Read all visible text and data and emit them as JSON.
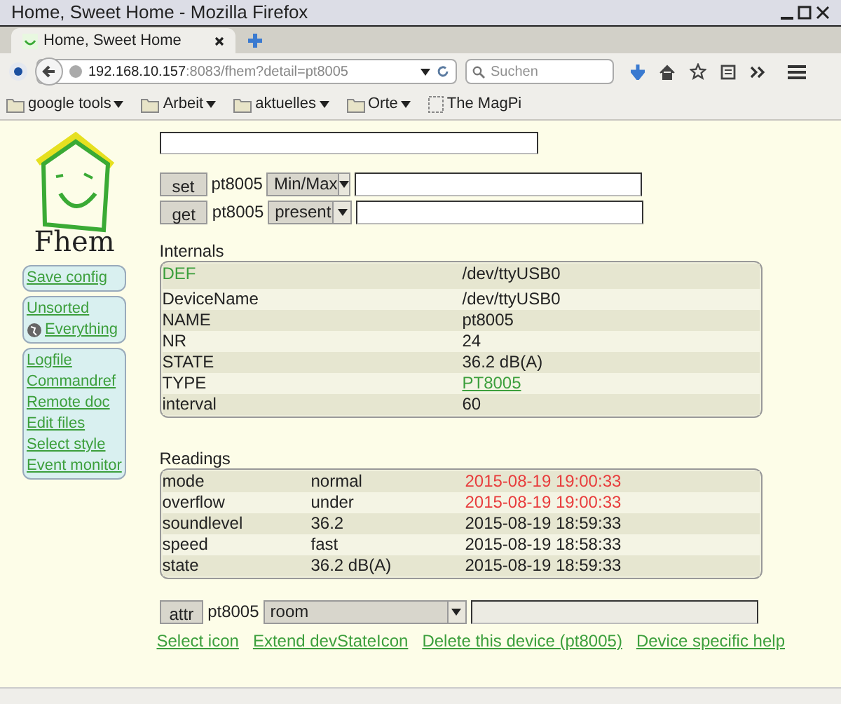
{
  "window": {
    "title": "Home, Sweet Home - Mozilla Firefox"
  },
  "tabs": [
    {
      "label": "Home, Sweet Home",
      "selected": true
    }
  ],
  "address": {
    "host": "192.168.10.157",
    "rest": ":8083/fhem?detail=pt8005"
  },
  "search": {
    "placeholder": "Suchen"
  },
  "bookmarks": [
    {
      "label": "google tools",
      "kind": "folder"
    },
    {
      "label": "Arbeit",
      "kind": "folder"
    },
    {
      "label": "aktuelles",
      "kind": "folder"
    },
    {
      "label": "Orte",
      "kind": "folder"
    },
    {
      "label": "The MagPi",
      "kind": "page"
    }
  ],
  "logo": {
    "text": "Fhem"
  },
  "sidebar": [
    {
      "items": [
        {
          "label": "Save config",
          "globe": false
        }
      ]
    },
    {
      "items": [
        {
          "label": "Unsorted",
          "globe": false
        },
        {
          "label": "Everything",
          "globe": true
        }
      ]
    },
    {
      "items": [
        {
          "label": "Logfile",
          "globe": false
        },
        {
          "label": "Commandref",
          "globe": false
        },
        {
          "label": "Remote doc",
          "globe": false
        },
        {
          "label": "Edit files",
          "globe": false
        },
        {
          "label": "Select style",
          "globe": false
        },
        {
          "label": "Event monitor",
          "globe": false
        }
      ]
    }
  ],
  "commands": [
    {
      "button": "set",
      "device": "pt8005",
      "select": "Min/Max"
    },
    {
      "button": "get",
      "device": "pt8005",
      "select": "present"
    }
  ],
  "internals": {
    "title": "Internals",
    "rows": [
      {
        "name": "DEF",
        "value": "/dev/ttyUSB0",
        "name_link": true,
        "value_link": false
      },
      {
        "name": "DeviceName",
        "value": "/dev/ttyUSB0",
        "name_link": false,
        "value_link": false
      },
      {
        "name": "NAME",
        "value": "pt8005",
        "name_link": false,
        "value_link": false
      },
      {
        "name": "NR",
        "value": "24",
        "name_link": false,
        "value_link": false
      },
      {
        "name": "STATE",
        "value": "36.2 dB(A)",
        "name_link": false,
        "value_link": false
      },
      {
        "name": "TYPE",
        "value": "PT8005",
        "name_link": false,
        "value_link": true
      },
      {
        "name": "interval",
        "value": "60",
        "name_link": false,
        "value_link": false
      }
    ]
  },
  "readings": {
    "title": "Readings",
    "rows": [
      {
        "name": "mode",
        "value": "normal",
        "time": "2015-08-19 19:00:33",
        "alert": true
      },
      {
        "name": "overflow",
        "value": "under",
        "time": "2015-08-19 19:00:33",
        "alert": true
      },
      {
        "name": "soundlevel",
        "value": "36.2",
        "time": "2015-08-19 18:59:33",
        "alert": false
      },
      {
        "name": "speed",
        "value": "fast",
        "time": "2015-08-19 18:58:33",
        "alert": false
      },
      {
        "name": "state",
        "value": "36.2 dB(A)",
        "time": "2015-08-19 18:59:33",
        "alert": false
      }
    ]
  },
  "attr": {
    "button": "attr",
    "device": "pt8005",
    "select": "room"
  },
  "links": [
    "Select icon",
    "Extend devStateIcon",
    "Delete this device (pt8005)",
    "Device specific help"
  ]
}
